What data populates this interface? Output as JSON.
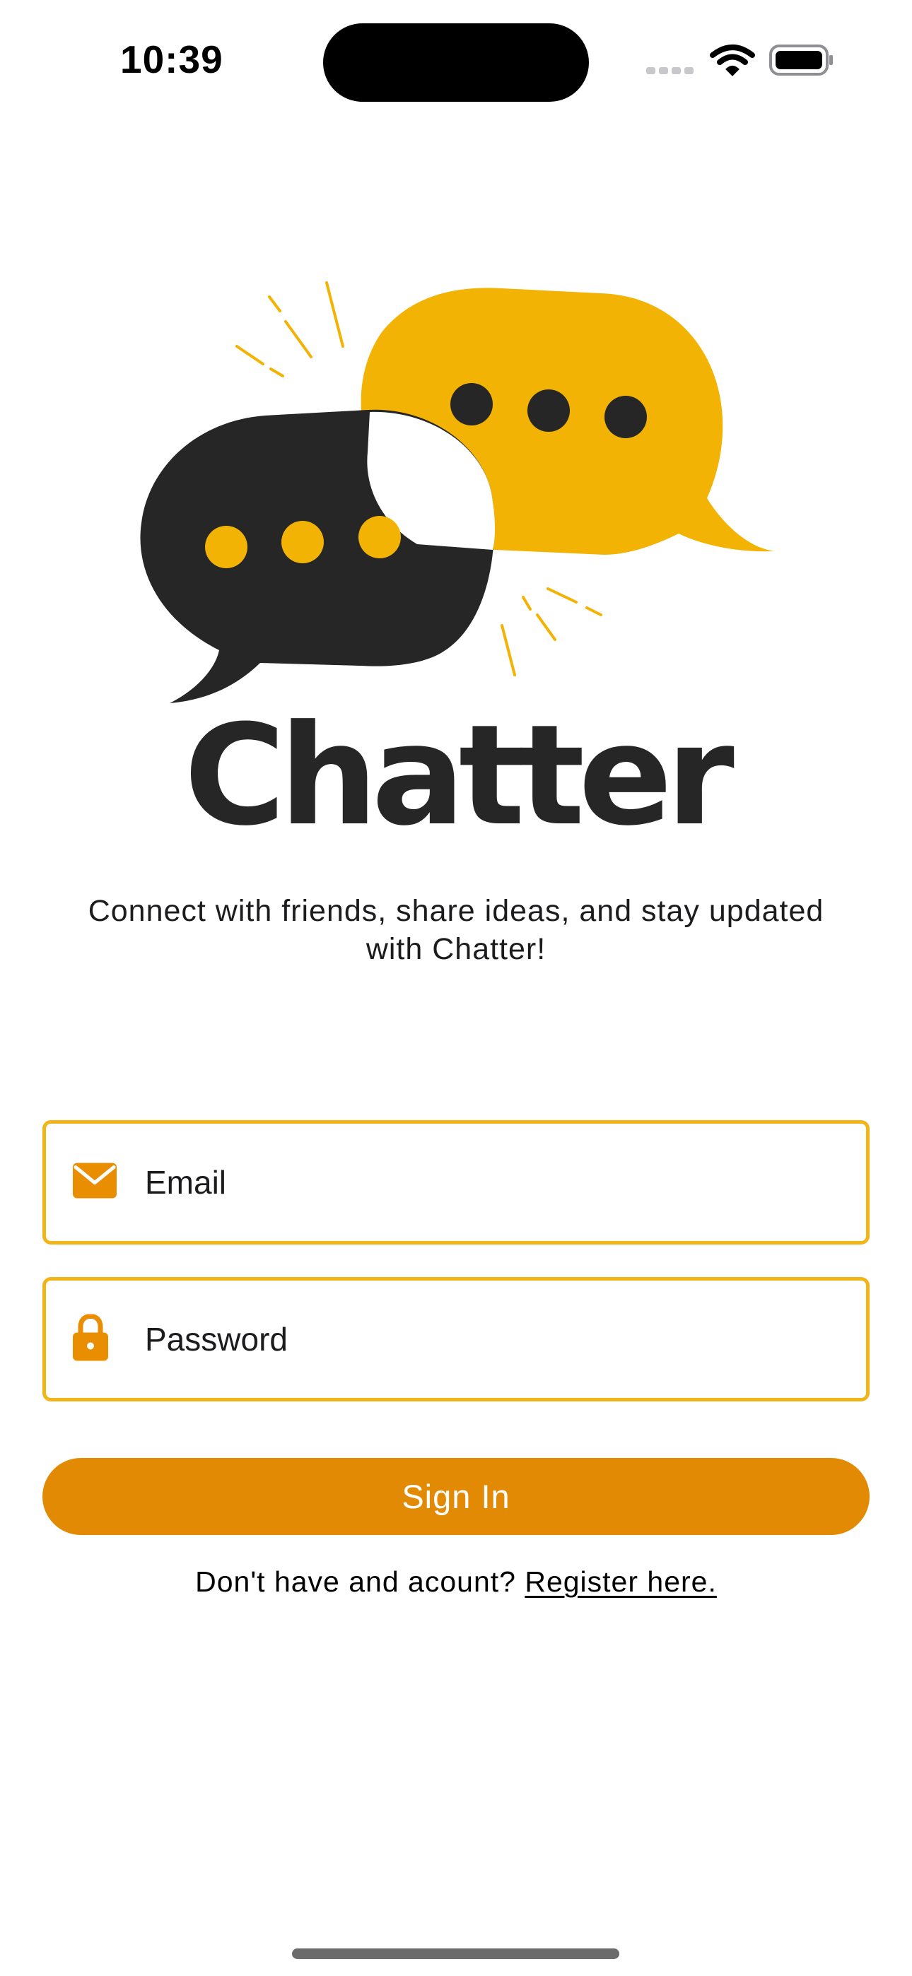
{
  "status_bar": {
    "time": "10:39",
    "icons": [
      "cellular-icon",
      "wifi-icon",
      "battery-icon"
    ]
  },
  "brand": {
    "logo_icon": "chat-bubbles-icon",
    "title": "Chatter",
    "tagline": "Connect with friends, share ideas, and stay updated with Chatter!"
  },
  "form": {
    "email": {
      "icon": "envelope-icon",
      "placeholder": "Email",
      "value": ""
    },
    "password": {
      "icon": "lock-icon",
      "placeholder": "Password",
      "value": ""
    },
    "sign_in_label": "Sign In"
  },
  "register": {
    "prompt": "Don't have and acount?",
    "link_label": "Register here."
  },
  "colors": {
    "accent_yellow": "#f3b304",
    "accent_orange": "#e38a05",
    "field_border": "#f1b51a",
    "dark": "#262626",
    "icon_orange": "#e88e00"
  }
}
